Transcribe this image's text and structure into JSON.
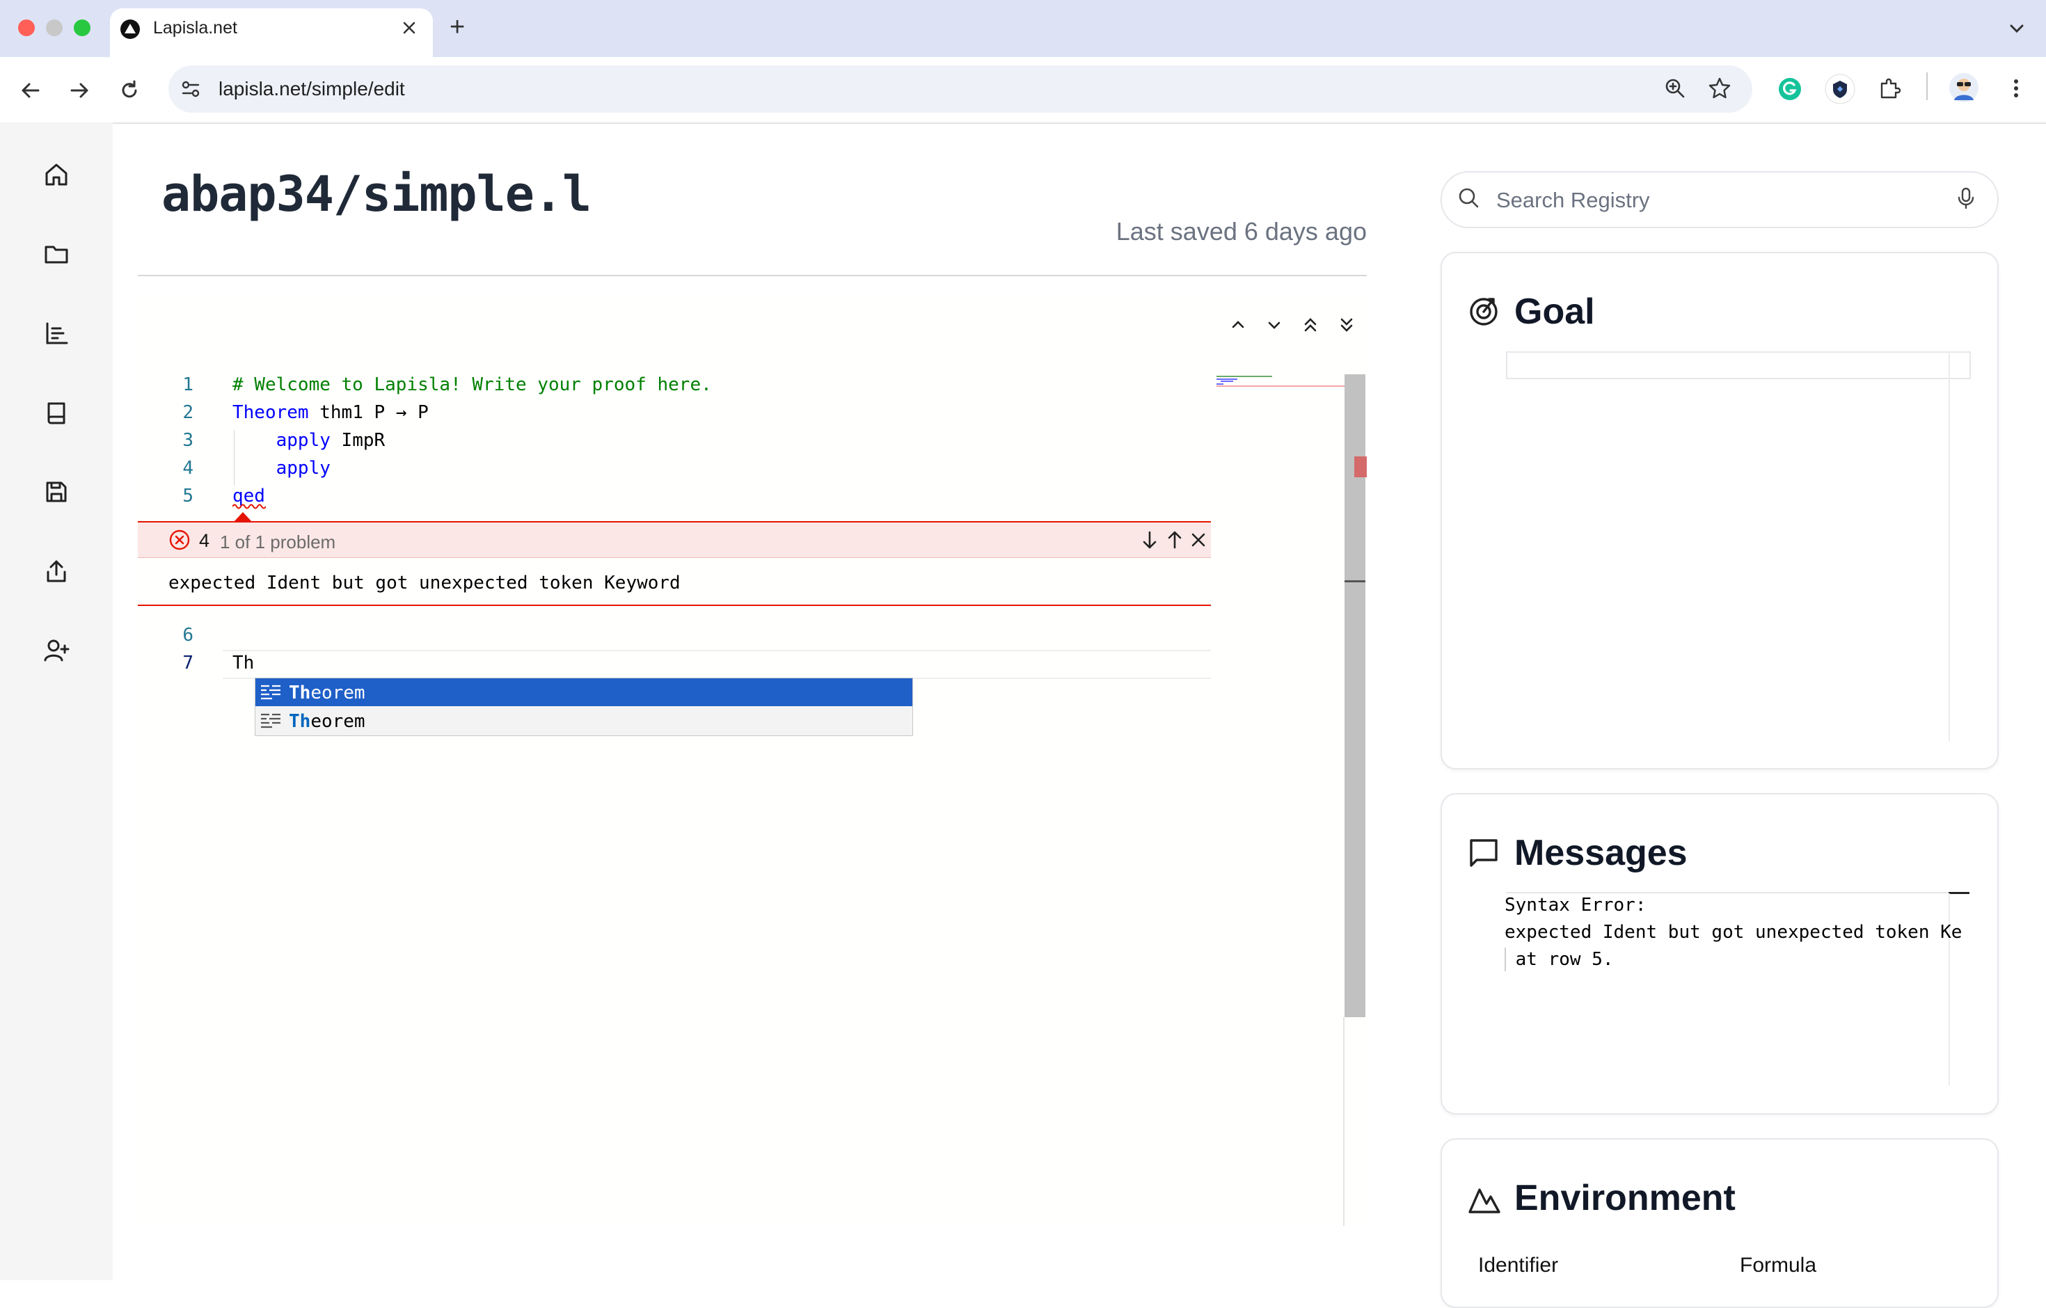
{
  "browser": {
    "tab_title": "Lapisla.net",
    "url_host": "lapisla.net",
    "url_path": "/simple/edit",
    "new_tab": "+"
  },
  "sidebar": {
    "items": [
      {
        "name": "home",
        "icon": "home-icon"
      },
      {
        "name": "files",
        "icon": "folder-icon"
      },
      {
        "name": "list",
        "icon": "list-icon"
      },
      {
        "name": "book",
        "icon": "book-icon"
      },
      {
        "name": "save",
        "icon": "save-icon"
      },
      {
        "name": "share",
        "icon": "share-icon"
      },
      {
        "name": "add-user",
        "icon": "user-plus-icon"
      }
    ]
  },
  "header": {
    "file_title": "abap34/simple.l",
    "last_saved": "Last saved 6 days ago"
  },
  "editor": {
    "lines": [
      {
        "num": "1",
        "tokens": [
          {
            "t": "# Welcome to Lapisla! Write your proof here.",
            "c": "cm"
          }
        ]
      },
      {
        "num": "2",
        "tokens": [
          {
            "t": "Theorem",
            "c": "kw"
          },
          {
            "t": " thm1 P → P",
            "c": "pl"
          }
        ]
      },
      {
        "num": "3",
        "tokens": [
          {
            "t": "    ",
            "c": "pl"
          },
          {
            "t": "apply",
            "c": "kw"
          },
          {
            "t": " ImpR",
            "c": "pl"
          }
        ]
      },
      {
        "num": "4",
        "tokens": [
          {
            "t": "    ",
            "c": "pl"
          },
          {
            "t": "apply",
            "c": "kw"
          }
        ]
      },
      {
        "num": "5",
        "tokens": [
          {
            "t": "qed",
            "c": "kw"
          }
        ]
      }
    ],
    "line6_num": "6",
    "line7_num": "7",
    "line7_text": "Th",
    "error_count": "4",
    "problem_text": "1 of 1 problem",
    "error_message": "expected Ident but got unexpected token Keyword",
    "suggestions": [
      {
        "match": "Th",
        "rest": "eorem",
        "selected": true
      },
      {
        "match": "Th",
        "rest": "eorem",
        "selected": false
      }
    ]
  },
  "search": {
    "placeholder": "Search Registry"
  },
  "goal": {
    "title": "Goal"
  },
  "messages": {
    "title": "Messages",
    "lines": [
      "Syntax Error:",
      "expected Ident but got unexpected token Ke",
      " at row 5."
    ]
  },
  "environment": {
    "title": "Environment",
    "columns": [
      "Identifier",
      "Formula"
    ]
  },
  "colors": {
    "keyword": "#0000ff",
    "comment": "#008000",
    "line_number": "#237893",
    "error": "#e51400",
    "suggest_selected": "#1f5fc8"
  }
}
